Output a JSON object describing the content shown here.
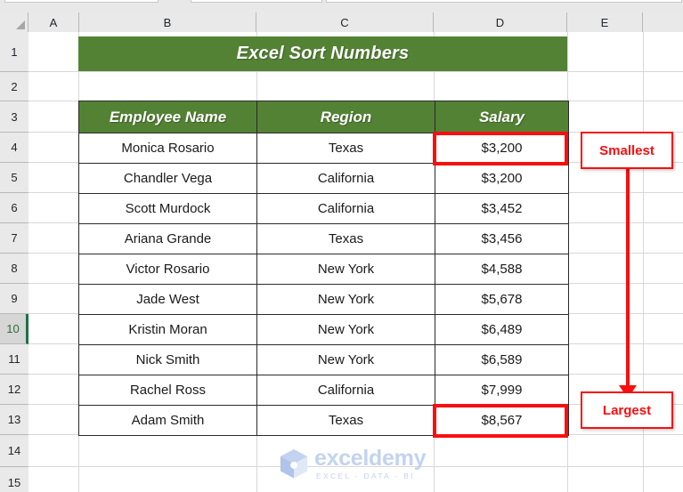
{
  "spreadsheet": {
    "column_headers": [
      "A",
      "B",
      "C",
      "D",
      "E"
    ],
    "row_headers": [
      "1",
      "2",
      "3",
      "4",
      "5",
      "6",
      "7",
      "8",
      "9",
      "10",
      "11",
      "12",
      "13",
      "14",
      "15"
    ],
    "active_row": "10",
    "select_all_icon": "select-all-triangle"
  },
  "title": {
    "text": "Excel Sort Numbers",
    "background_color": "#548235",
    "text_color": "#FFFFFF"
  },
  "table": {
    "headers": [
      "Employee Name",
      "Region",
      "Salary"
    ],
    "header_background": "#548235",
    "rows": [
      {
        "name": "Monica Rosario",
        "region": "Texas",
        "salary": "$3,200"
      },
      {
        "name": "Chandler Vega",
        "region": "California",
        "salary": "$3,200"
      },
      {
        "name": "Scott Murdock",
        "region": "California",
        "salary": "$3,452"
      },
      {
        "name": "Ariana Grande",
        "region": "Texas",
        "salary": "$3,456"
      },
      {
        "name": "Victor Rosario",
        "region": "New York",
        "salary": "$4,588"
      },
      {
        "name": "Jade West",
        "region": "New York",
        "salary": "$5,678"
      },
      {
        "name": "Kristin Moran",
        "region": "New York",
        "salary": "$6,489"
      },
      {
        "name": "Nick Smith",
        "region": "New York",
        "salary": "$6,589"
      },
      {
        "name": "Rachel Ross",
        "region": "California",
        "salary": "$7,999"
      },
      {
        "name": "Adam Smith",
        "region": "Texas",
        "salary": "$8,567"
      }
    ]
  },
  "annotations": {
    "highlight_color": "#F70F0F",
    "smallest_label": "Smallest",
    "largest_label": "Largest",
    "arrow_icon": "down-arrow-icon",
    "highlighted_cells": [
      "$3,200",
      "$8,567"
    ]
  },
  "watermark": {
    "name": "exceldemy",
    "tagline": "EXCEL - DATA - BI",
    "logo_icon": "exceldemy-cube-logo",
    "color": "#C3D3EF"
  }
}
